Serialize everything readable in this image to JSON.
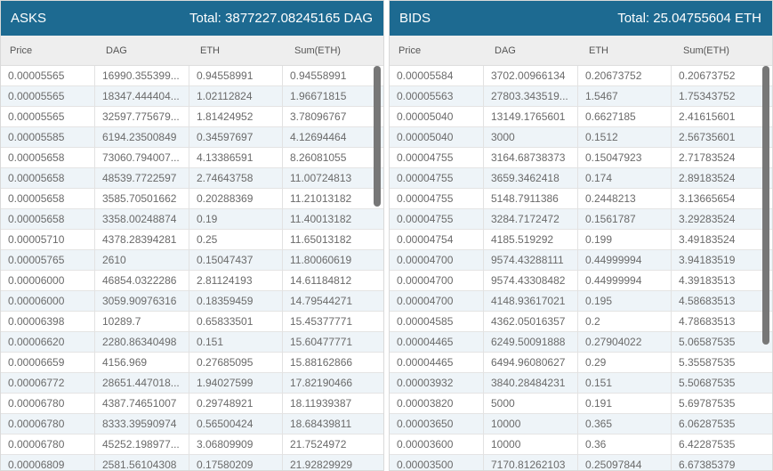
{
  "asks": {
    "title": "ASKS",
    "total": "Total: 3877227.08245165 DAG",
    "columns": [
      "Price",
      "DAG",
      "ETH",
      "Sum(ETH)"
    ],
    "rows": [
      [
        "0.00005565",
        "16990.355399...",
        "0.94558991",
        "0.94558991"
      ],
      [
        "0.00005565",
        "18347.444404...",
        "1.02112824",
        "1.96671815"
      ],
      [
        "0.00005565",
        "32597.775679...",
        "1.81424952",
        "3.78096767"
      ],
      [
        "0.00005585",
        "6194.23500849",
        "0.34597697",
        "4.12694464"
      ],
      [
        "0.00005658",
        "73060.794007...",
        "4.13386591",
        "8.26081055"
      ],
      [
        "0.00005658",
        "48539.7722597",
        "2.74643758",
        "11.00724813"
      ],
      [
        "0.00005658",
        "3585.70501662",
        "0.20288369",
        "11.21013182"
      ],
      [
        "0.00005658",
        "3358.00248874",
        "0.19",
        "11.40013182"
      ],
      [
        "0.00005710",
        "4378.28394281",
        "0.25",
        "11.65013182"
      ],
      [
        "0.00005765",
        "2610",
        "0.15047437",
        "11.80060619"
      ],
      [
        "0.00006000",
        "46854.0322286",
        "2.81124193",
        "14.61184812"
      ],
      [
        "0.00006000",
        "3059.90976316",
        "0.18359459",
        "14.79544271"
      ],
      [
        "0.00006398",
        "10289.7",
        "0.65833501",
        "15.45377771"
      ],
      [
        "0.00006620",
        "2280.86340498",
        "0.151",
        "15.60477771"
      ],
      [
        "0.00006659",
        "4156.969",
        "0.27685095",
        "15.88162866"
      ],
      [
        "0.00006772",
        "28651.447018...",
        "1.94027599",
        "17.82190466"
      ],
      [
        "0.00006780",
        "4387.74651007",
        "0.29748921",
        "18.11939387"
      ],
      [
        "0.00006780",
        "8333.39590974",
        "0.56500424",
        "18.68439811"
      ],
      [
        "0.00006780",
        "45252.198977...",
        "3.06809909",
        "21.7524972"
      ],
      [
        "0.00006809",
        "2581.56104308",
        "0.17580209",
        "21.92829929"
      ]
    ]
  },
  "bids": {
    "title": "BIDS",
    "total": "Total: 25.04755604 ETH",
    "columns": [
      "Price",
      "DAG",
      "ETH",
      "Sum(ETH)"
    ],
    "rows": [
      [
        "0.00005584",
        "3702.00966134",
        "0.20673752",
        "0.20673752"
      ],
      [
        "0.00005563",
        "27803.343519...",
        "1.5467",
        "1.75343752"
      ],
      [
        "0.00005040",
        "13149.1765601",
        "0.6627185",
        "2.41615601"
      ],
      [
        "0.00005040",
        "3000",
        "0.1512",
        "2.56735601"
      ],
      [
        "0.00004755",
        "3164.68738373",
        "0.15047923",
        "2.71783524"
      ],
      [
        "0.00004755",
        "3659.3462418",
        "0.174",
        "2.89183524"
      ],
      [
        "0.00004755",
        "5148.7911386",
        "0.2448213",
        "3.13665654"
      ],
      [
        "0.00004755",
        "3284.7172472",
        "0.1561787",
        "3.29283524"
      ],
      [
        "0.00004754",
        "4185.519292",
        "0.199",
        "3.49183524"
      ],
      [
        "0.00004700",
        "9574.43288111",
        "0.44999994",
        "3.94183519"
      ],
      [
        "0.00004700",
        "9574.43308482",
        "0.44999994",
        "4.39183513"
      ],
      [
        "0.00004700",
        "4148.93617021",
        "0.195",
        "4.58683513"
      ],
      [
        "0.00004585",
        "4362.05016357",
        "0.2",
        "4.78683513"
      ],
      [
        "0.00004465",
        "6249.50091888",
        "0.27904022",
        "5.06587535"
      ],
      [
        "0.00004465",
        "6494.96080627",
        "0.29",
        "5.35587535"
      ],
      [
        "0.00003932",
        "3840.28484231",
        "0.151",
        "5.50687535"
      ],
      [
        "0.00003820",
        "5000",
        "0.191",
        "5.69787535"
      ],
      [
        "0.00003650",
        "10000",
        "0.365",
        "6.06287535"
      ],
      [
        "0.00003600",
        "10000",
        "0.36",
        "6.42287535"
      ],
      [
        "0.00003500",
        "7170.81262103",
        "0.25097844",
        "6.67385379"
      ]
    ]
  }
}
